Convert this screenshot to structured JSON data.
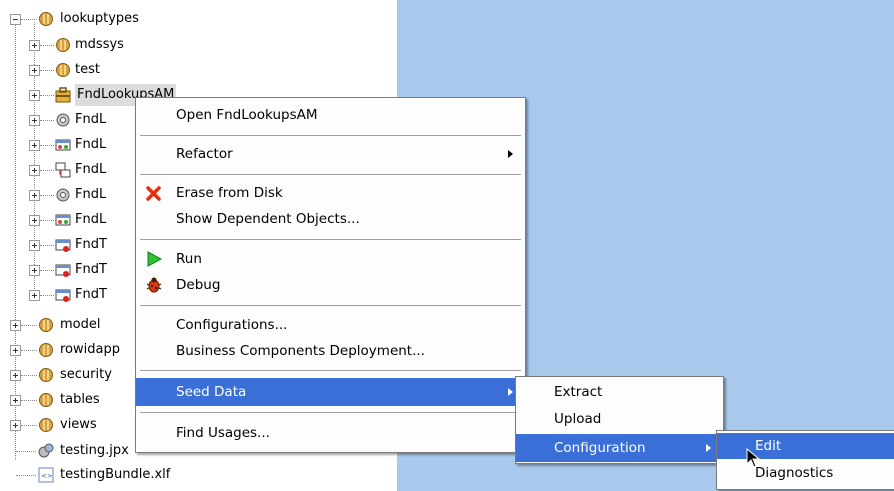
{
  "tree": {
    "items": [
      {
        "label": "lookuptypes",
        "expanded": true,
        "icon": "package-icon"
      },
      {
        "label": "mdssys",
        "expanded": false,
        "icon": "package-icon"
      },
      {
        "label": "test",
        "expanded": false,
        "icon": "package-icon"
      },
      {
        "label": "FndLookupsAM",
        "expanded": false,
        "icon": "application-module-icon"
      },
      {
        "label": "FndL",
        "expanded": false,
        "icon": "entity-object-icon"
      },
      {
        "label": "FndL",
        "expanded": false,
        "icon": "view-object-icon"
      },
      {
        "label": "FndL",
        "expanded": false,
        "icon": "view-link-icon"
      },
      {
        "label": "FndL",
        "expanded": false,
        "icon": "entity-object-icon"
      },
      {
        "label": "FndL",
        "expanded": false,
        "icon": "view-object-icon"
      },
      {
        "label": "FndT",
        "expanded": false,
        "icon": "view-object-error-icon"
      },
      {
        "label": "FndT",
        "expanded": false,
        "icon": "view-object-error-icon"
      },
      {
        "label": "FndT",
        "expanded": false,
        "icon": "view-object-error-icon"
      },
      {
        "label": "model",
        "expanded": false,
        "icon": "package-icon"
      },
      {
        "label": "rowidapp",
        "expanded": false,
        "icon": "package-icon"
      },
      {
        "label": "security",
        "expanded": false,
        "icon": "package-icon"
      },
      {
        "label": "tables",
        "expanded": false,
        "icon": "package-icon"
      },
      {
        "label": "views",
        "expanded": false,
        "icon": "package-icon"
      },
      {
        "label": "testing.jpx",
        "expanded": null,
        "icon": "project-file-icon"
      },
      {
        "label": "testingBundle.xlf",
        "expanded": null,
        "icon": "resource-bundle-icon"
      }
    ]
  },
  "context_menu": {
    "open": "Open FndLookupsAM",
    "refactor": "Refactor",
    "erase": "Erase from Disk",
    "show_dependent": "Show Dependent Objects...",
    "run": "Run",
    "debug": "Debug",
    "configurations": "Configurations...",
    "bc_deployment": "Business Components Deployment...",
    "seed_data": "Seed Data",
    "find_usages": "Find Usages..."
  },
  "seed_submenu": {
    "extract": "Extract",
    "upload": "Upload",
    "configuration": "Configuration"
  },
  "config_submenu": {
    "edit": "Edit",
    "diagnostics": "Diagnostics"
  },
  "colors": {
    "highlight": "#3a6fd8",
    "right_pane": "#a8c8ec",
    "menu_bg": "#fdfdfd"
  }
}
